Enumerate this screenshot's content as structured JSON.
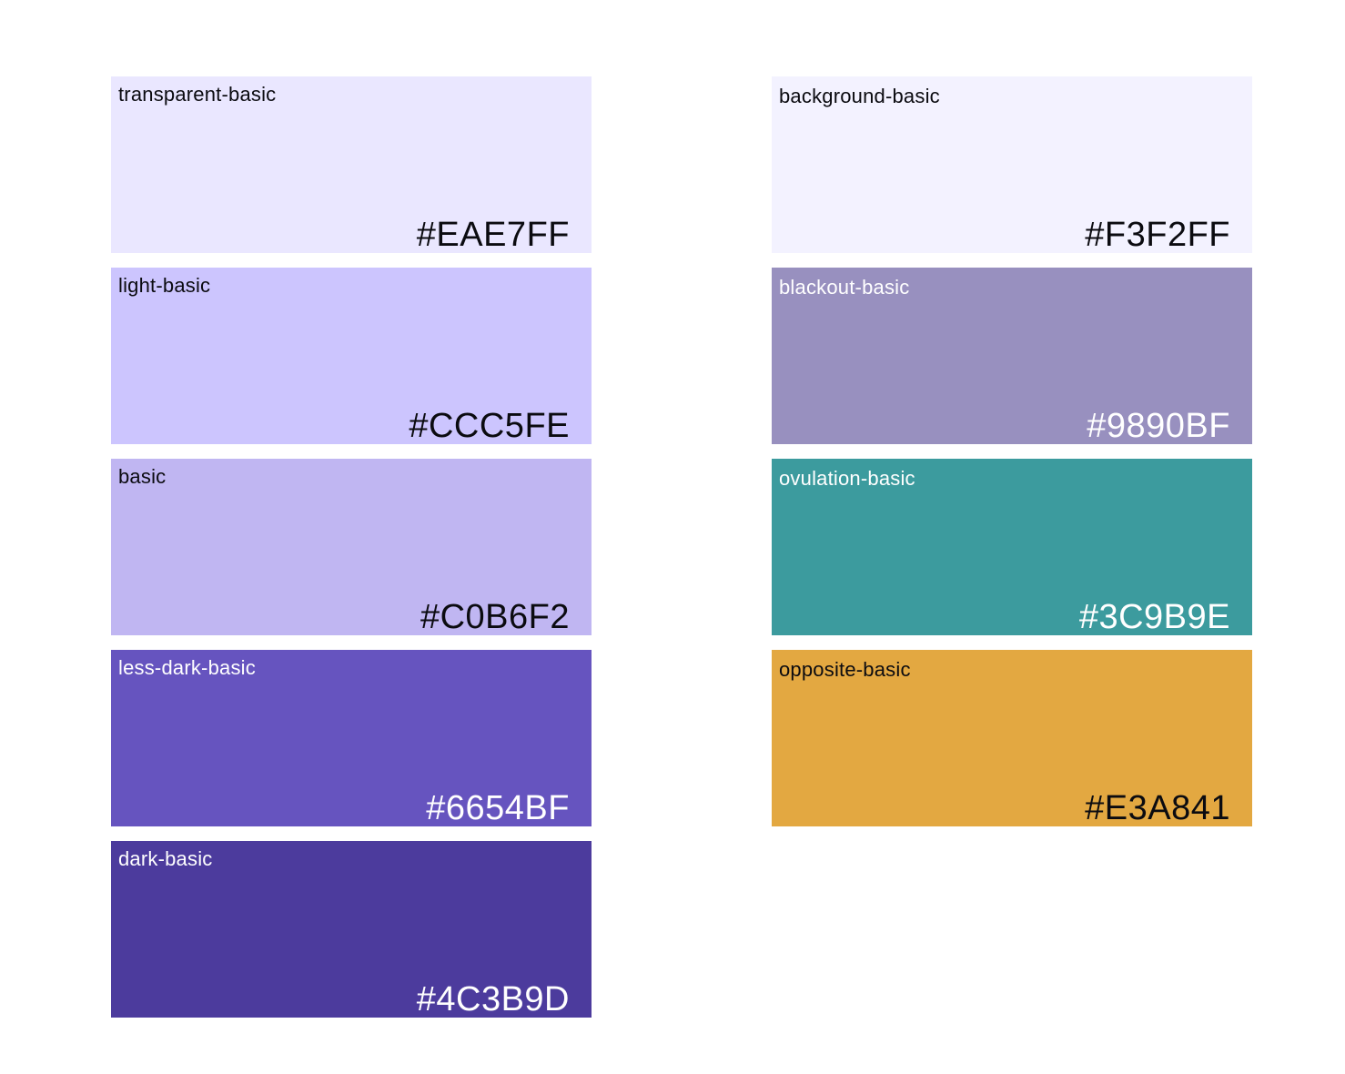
{
  "palette": {
    "left": [
      {
        "name": "transparent-basic",
        "hex": "#EAE7FF",
        "color": "#EAE7FF",
        "text_color": "#0B0B10"
      },
      {
        "name": "light-basic",
        "hex": "#CCC5FE",
        "color": "#CCC5FE",
        "text_color": "#0B0B10"
      },
      {
        "name": "basic",
        "hex": "#C0B6F2",
        "color": "#C0B6F2",
        "text_color": "#0B0B10"
      },
      {
        "name": "less-dark-basic",
        "hex": "#6654BF",
        "color": "#6654BF",
        "text_color": "#FFFFFF"
      },
      {
        "name": "dark-basic",
        "hex": "#4C3B9D",
        "color": "#4C3B9D",
        "text_color": "#FFFFFF"
      }
    ],
    "right": [
      {
        "name": "background-basic",
        "hex": "#F3F2FF",
        "color": "#F3F2FF",
        "text_color": "#0B0B10"
      },
      {
        "name": "blackout-basic",
        "hex": "#9890BF",
        "color": "#9890BF",
        "text_color": "#FFFFFF"
      },
      {
        "name": "ovulation-basic",
        "hex": "#3C9B9E",
        "color": "#3C9B9E",
        "text_color": "#FFFFFF"
      },
      {
        "name": "opposite-basic",
        "hex": "#E3A841",
        "color": "#E3A841",
        "text_color": "#0B0B10"
      }
    ]
  }
}
